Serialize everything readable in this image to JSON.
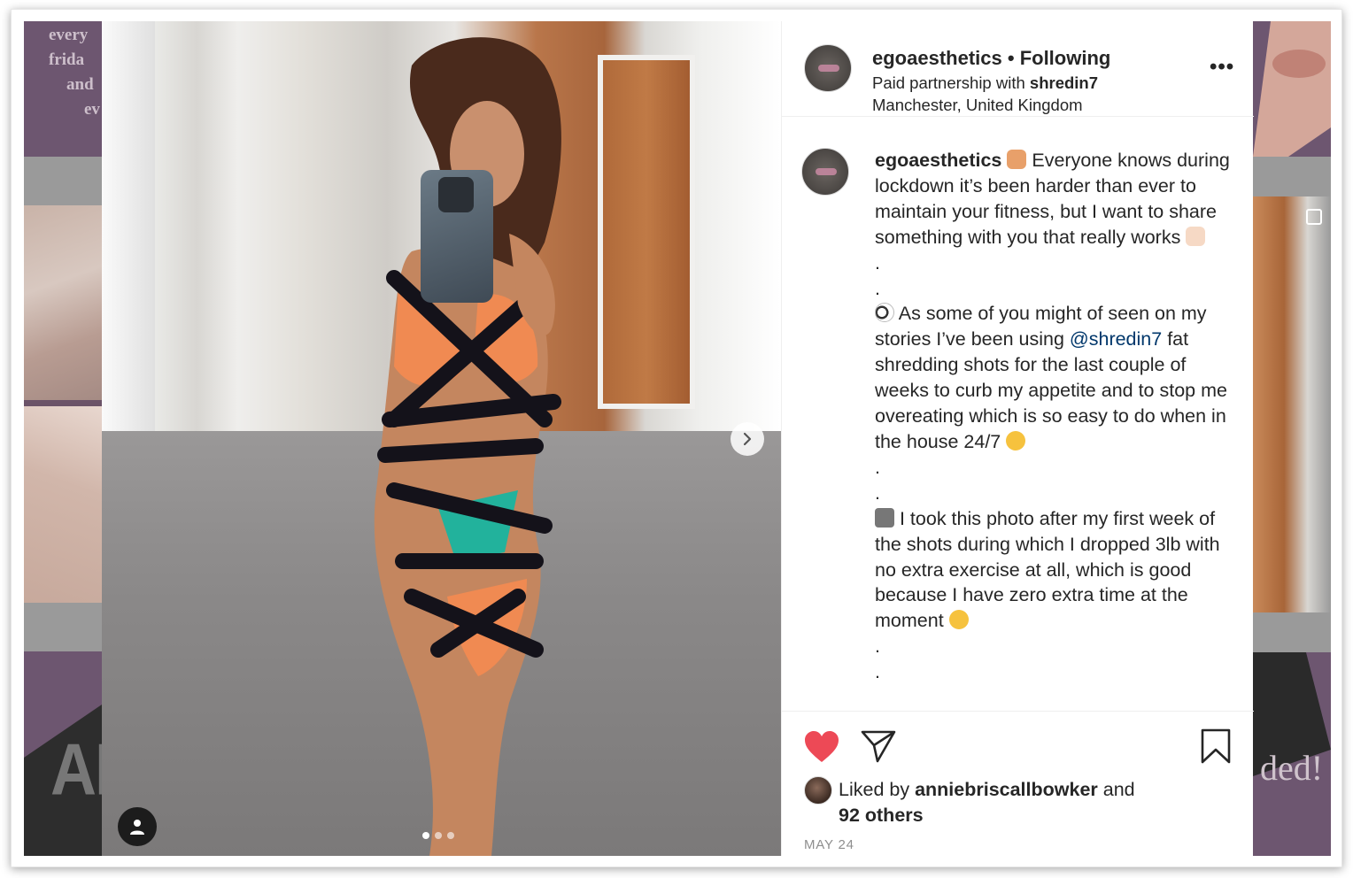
{
  "header": {
    "username": "egoaesthetics",
    "separator": "•",
    "follow_status": "Following",
    "paid_prefix": "Paid partnership with ",
    "partner": "shredin7",
    "location": "Manchester, United Kingdom",
    "more_label": "•••"
  },
  "caption": {
    "username": "egoaesthetics",
    "line1": "Everyone knows during lockdown it’s been harder than ever to maintain your fitness, but I want to share something with you that really works",
    "dot": ".",
    "para2_start": "As some of you might of seen on my stories I’ve been using ",
    "mention": "@shredin7",
    "para2_end": " fat shredding shots for the last couple of weeks to curb my appetite and to stop me overeating which is so easy to do when in the house 24/7",
    "para3": "I took this photo after my first week of the shots during which I dropped 3lb with no extra exercise at all, which is good because I have zero extra time at the moment"
  },
  "likes": {
    "prefix": "Liked by ",
    "user": "anniebriscallbowker",
    "and": " and",
    "others": "92 others"
  },
  "date": "MAY 24",
  "background": {
    "left_text": [
      "every",
      "frida",
      "and",
      "ev"
    ],
    "left_big": "AP",
    "right_text": "ded!"
  },
  "colors": {
    "like_red": "#ed4956",
    "mention_blue": "#00376b",
    "text": "#262626",
    "muted": "#8e8e8e"
  },
  "icons": {
    "like": "heart-icon",
    "share": "paper-plane-icon",
    "save": "bookmark-icon",
    "next": "chevron-right-icon",
    "user_tag": "user-icon"
  },
  "carousel": {
    "count": 3,
    "active_index": 0
  }
}
